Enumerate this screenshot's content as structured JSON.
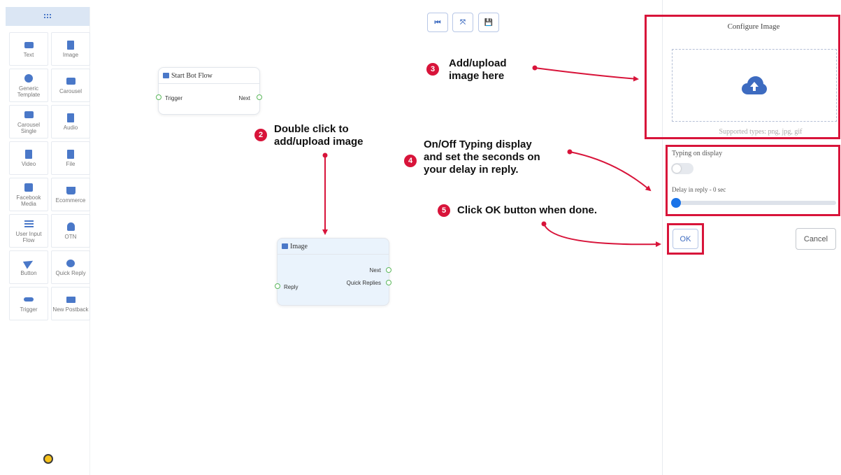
{
  "sidebar": {
    "items": [
      {
        "label": "Text",
        "icon": "keyboard-icon"
      },
      {
        "label": "Image",
        "icon": "image-file-icon"
      },
      {
        "label": "Generic Template",
        "icon": "template-icon"
      },
      {
        "label": "Carousel",
        "icon": "carousel-icon"
      },
      {
        "label": "Carousel Single",
        "icon": "carousel-single-icon"
      },
      {
        "label": "Audio",
        "icon": "audio-file-icon"
      },
      {
        "label": "Video",
        "icon": "video-file-icon"
      },
      {
        "label": "File",
        "icon": "file-download-icon"
      },
      {
        "label": "Facebook Media",
        "icon": "facebook-icon"
      },
      {
        "label": "Ecommerce",
        "icon": "cart-icon"
      },
      {
        "label": "User Input Flow",
        "icon": "lines-icon"
      },
      {
        "label": "OTN",
        "icon": "bell-icon"
      },
      {
        "label": "Button",
        "icon": "send-icon"
      },
      {
        "label": "Quick Reply",
        "icon": "chat-bubble-icon"
      },
      {
        "label": "Trigger",
        "icon": "takeoff-icon"
      },
      {
        "label": "New Postback",
        "icon": "envelope-icon"
      }
    ]
  },
  "toolbar": {
    "reset_glyph": "⏮",
    "fit_glyph": "⤧",
    "save_glyph": "💾"
  },
  "nodes": {
    "start": {
      "title": "Start Bot Flow",
      "trigger": "Trigger",
      "next": "Next"
    },
    "image": {
      "title": "Image",
      "next": "Next",
      "quick_replies": "Quick Replies",
      "reply": "Reply"
    }
  },
  "annotations": {
    "step2": {
      "num": "2",
      "line1": "Double click to",
      "line2": "add/upload image"
    },
    "step3": {
      "num": "3",
      "line1": "Add/upload",
      "line2": "image here"
    },
    "step4": {
      "num": "4",
      "line1": "On/Off Typing display",
      "line2": "and set the seconds on",
      "line3": "your delay in reply."
    },
    "step5": {
      "num": "5",
      "line1": "Click OK button when done."
    }
  },
  "panel": {
    "title": "Configure Image",
    "supported": "Supported types: png, jpg, gif",
    "typing_label": "Typing on display",
    "typing_on": false,
    "delay_label": "Delay in reply",
    "delay_sep": "-",
    "delay_value": "0 sec",
    "delay_fraction": 0,
    "ok_label": "OK",
    "cancel_label": "Cancel"
  },
  "colors": {
    "accent": "#4a78c8",
    "annotation": "#d8143a",
    "upload_icon": "#3d6bc0"
  }
}
